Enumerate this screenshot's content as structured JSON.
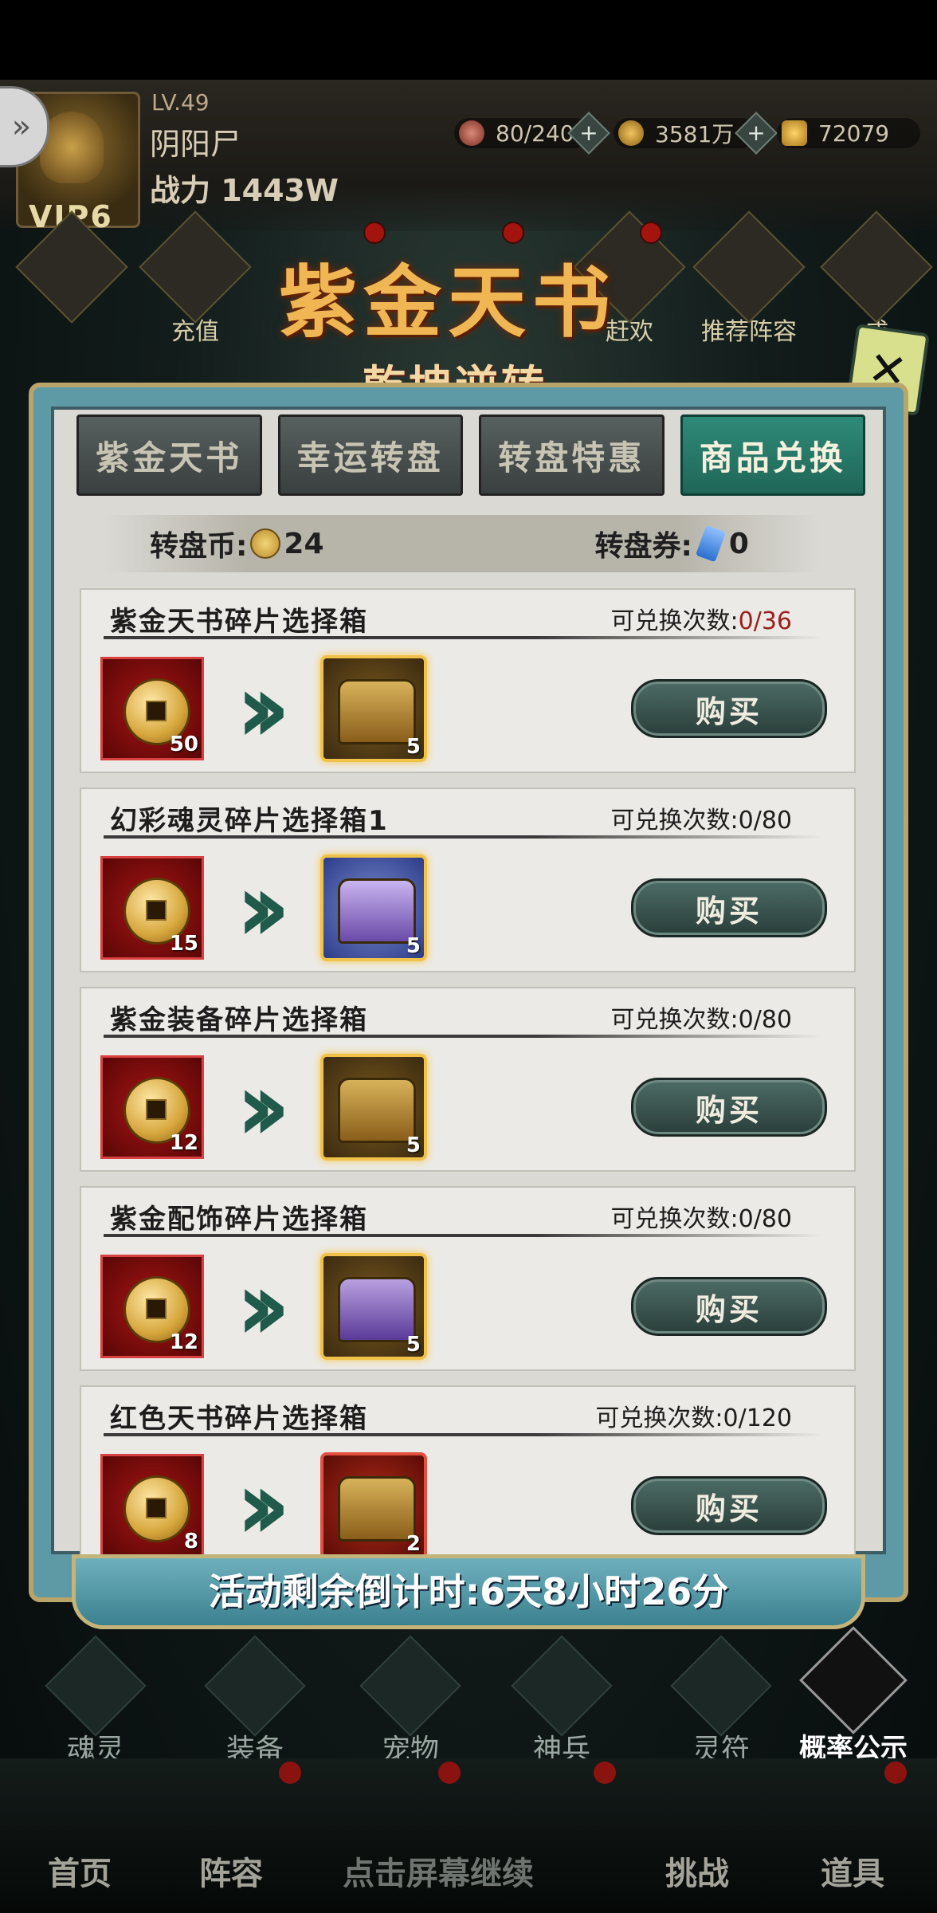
{
  "player": {
    "level": "LV.49",
    "name": "阴阳尸",
    "power": "战力 1443W",
    "vip": "VIP6"
  },
  "resources": [
    {
      "icon": "stamina-icon",
      "value": "80/240"
    },
    {
      "icon": "copper-coin-icon",
      "value": "3581万"
    },
    {
      "icon": "gold-ingot-icon",
      "value": "72079"
    }
  ],
  "top_icons": {
    "recharge": "充值",
    "partial_left": "赶欢",
    "recommend": "推荐阵容",
    "partial_right": "成"
  },
  "banner": {
    "title": "紫金天书",
    "subtitle": "乾坤逆转"
  },
  "tabs": [
    {
      "label": "紫金天书",
      "active": false
    },
    {
      "label": "幸运转盘",
      "active": false
    },
    {
      "label": "转盘特惠",
      "active": false
    },
    {
      "label": "商品兑换",
      "active": true
    }
  ],
  "currency": {
    "coin_label": "转盘币:",
    "coin_value": "24",
    "ticket_label": "转盘券:",
    "ticket_value": "0"
  },
  "exchange_label": "可兑换次数:",
  "buy_label": "购买",
  "items": [
    {
      "name": "紫金天书碎片选择箱",
      "count": "0/36",
      "cost": "50",
      "reward_qty": "5"
    },
    {
      "name": "幻彩魂灵碎片选择箱1",
      "count": "0/80",
      "cost": "15",
      "reward_qty": "5"
    },
    {
      "name": "紫金装备碎片选择箱",
      "count": "0/80",
      "cost": "12",
      "reward_qty": "5"
    },
    {
      "name": "紫金配饰碎片选择箱",
      "count": "0/80",
      "cost": "12",
      "reward_qty": "5"
    },
    {
      "name": "红色天书碎片选择箱",
      "count": "0/120",
      "cost": "8",
      "reward_qty": "2"
    }
  ],
  "countdown": "活动剩余倒计时:6天8小时26分",
  "bottom_features": [
    "魂灵",
    "装备",
    "宠物",
    "神兵",
    "灵符"
  ],
  "probability": "概率公示",
  "nav": {
    "home": "首页",
    "lineup": "阵容",
    "tap_hint": "点击屏幕继续",
    "challenge": "挑战",
    "items": "道具"
  },
  "colors": {
    "active_tab": "#2f8a78",
    "panel_frame": "#5e99a6",
    "limit_red": "#9b1f1f",
    "title_gold": "#f0b654"
  }
}
